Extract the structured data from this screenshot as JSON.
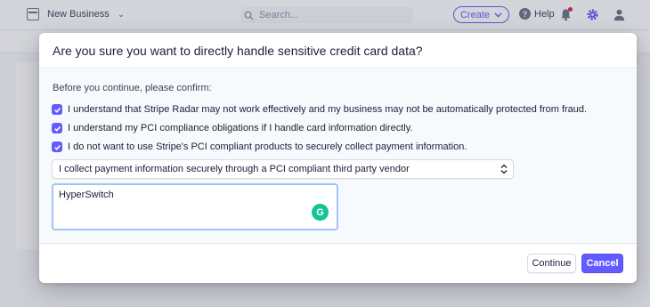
{
  "topbar": {
    "business_name": "New Business",
    "search_placeholder": "Search...",
    "create_label": "Create",
    "help_label": "Help"
  },
  "modal": {
    "title": "Are you sure you want to directly handle sensitive credit card data?",
    "intro": "Before you continue, please confirm:",
    "checks": [
      {
        "label": "I understand that Stripe Radar may not work effectively and my business may not be automatically protected from fraud.",
        "checked": true
      },
      {
        "label": "I understand my PCI compliance obligations if I handle card information directly.",
        "checked": true
      },
      {
        "label": "I do not want to use Stripe's PCI compliant products to securely collect payment information.",
        "checked": true
      }
    ],
    "select_value": "I collect payment information securely through a PCI compliant third party vendor",
    "textarea_value": "HyperSwitch",
    "continue_label": "Continue",
    "cancel_label": "Cancel"
  },
  "colors": {
    "accent": "#635bff",
    "grammarly": "#15c39a"
  }
}
